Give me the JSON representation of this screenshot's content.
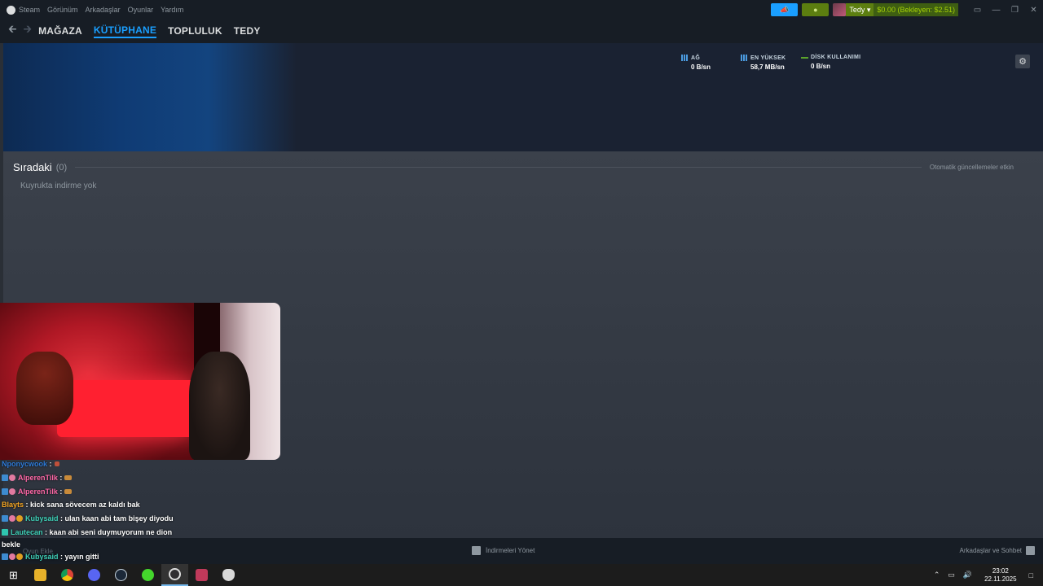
{
  "menubar": {
    "items": [
      "Steam",
      "Görünüm",
      "Arkadaşlar",
      "Oyunlar",
      "Yardım"
    ],
    "user_name": "Tedy",
    "wallet": "$0.00 (Bekleyen: $2.51)"
  },
  "nav": {
    "links": [
      "MAĞAZA",
      "KÜTÜPHANE",
      "TOPLULUK",
      "TEDY"
    ],
    "active": "KÜTÜPHANE"
  },
  "stats": {
    "network_label": "AĞ",
    "network_value": "0 B/sn",
    "peak_label": "EN YÜKSEK",
    "peak_value": "58,7 MB/sn",
    "disk_label": "DİSK KULLANIMI",
    "disk_value": "0 B/sn"
  },
  "queue": {
    "title": "Sıradaki",
    "count": "(0)",
    "auto_update": "Otomatik güncellemeler etkin",
    "empty_text": "Kuyrukta indirme yok"
  },
  "chat": {
    "lines": [
      {
        "nick": "Nponycwook",
        "sep": ":",
        "msg": ""
      },
      {
        "nick": "AlperenTilk",
        "sep": ":",
        "msg": ""
      },
      {
        "nick": "AlperenTilk",
        "sep": ":",
        "msg": ""
      },
      {
        "nick": "Blayts",
        "sep": ":",
        "msg": "kick sana sövecem az kaldı bak"
      },
      {
        "nick": "Kubysaid",
        "sep": ":",
        "msg": "ulan kaan abi tam bişey diyodu"
      },
      {
        "nick": "Lautecan",
        "sep": ":",
        "msg": "kaan abi seni duymuyorum ne dion"
      },
      {
        "nick": "",
        "sep": "",
        "msg": "bekle"
      },
      {
        "nick": "Kubysaid",
        "sep": ":",
        "msg": "yayın gitti"
      }
    ]
  },
  "bottom": {
    "add_game": "Oyun Ekle",
    "manage_downloads": "İndirmeleri Yönet",
    "friends_chat": "Arkadaşlar ve Sohbet"
  },
  "taskbar": {
    "time": "23:02",
    "date": "22.11.2025"
  },
  "colors": {
    "accent_blue": "#1a9fff",
    "green": "#5c7e10",
    "background": "#171d25"
  }
}
